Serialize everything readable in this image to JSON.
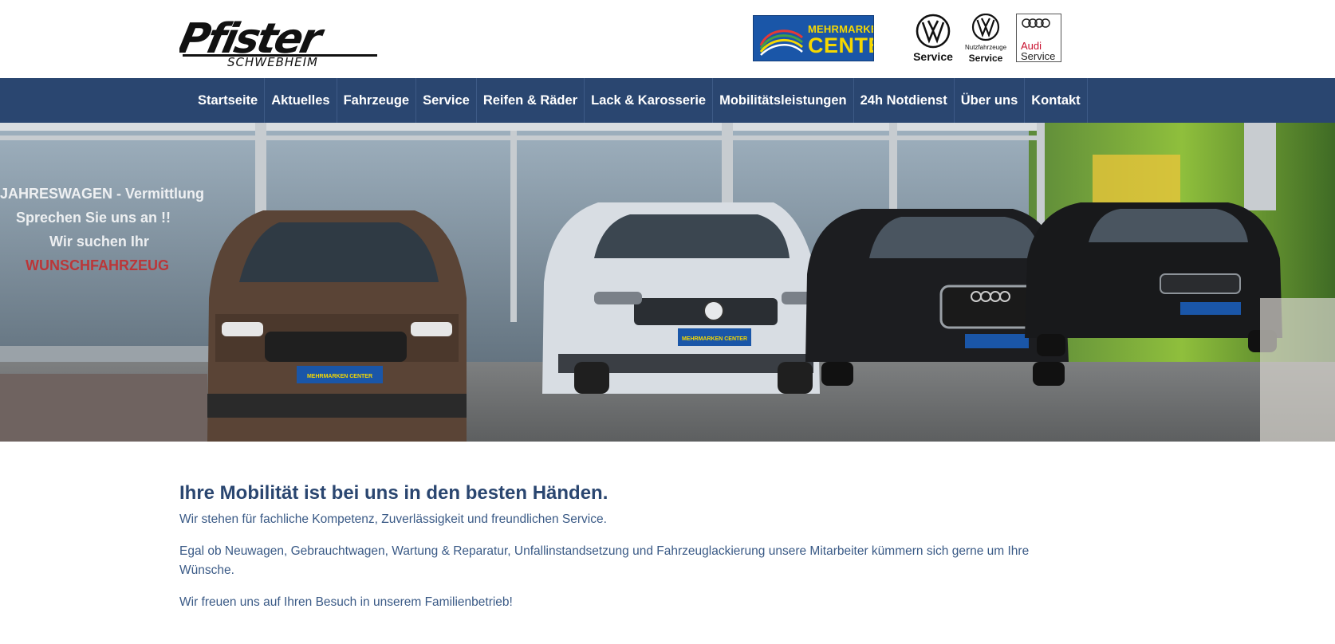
{
  "logo": {
    "name": "Pfister",
    "subtitle": "SCHWEBHEIM"
  },
  "brands": {
    "mehrmarken": {
      "top": "MEHRMARKEN",
      "bottom": "CENTER"
    },
    "vw": {
      "label": "Service"
    },
    "vw_nutzfahrzeuge": {
      "small": "Nutzfahrzeuge",
      "label": "Service"
    },
    "audi": {
      "line1": "Audi",
      "line2": "Service"
    }
  },
  "nav": {
    "items": [
      {
        "label": "Startseite"
      },
      {
        "label": "Aktuelles"
      },
      {
        "label": "Fahrzeuge"
      },
      {
        "label": "Service"
      },
      {
        "label": "Reifen & Räder"
      },
      {
        "label": "Lack & Karosserie"
      },
      {
        "label": "Mobilitätsleistungen"
      },
      {
        "label": "24h Notdienst"
      },
      {
        "label": "Über uns"
      },
      {
        "label": "Kontakt"
      }
    ]
  },
  "hero": {
    "window_text": [
      "JAHRESWAGEN - Vermittlung",
      "Sprechen Sie uns an !!",
      "Wir suchen Ihr",
      "WUNSCHFAHRZEUG"
    ],
    "plate_text": "MEHRMARKEN CENTER"
  },
  "content": {
    "heading": "Ihre Mobilität ist bei uns in den besten Händen.",
    "paragraph1": "Wir stehen für fachliche Kompetenz, Zuverlässigkeit und freundlichen Service.",
    "paragraph2": "Egal ob Neuwagen, Gebrauchtwagen, Wartung & Reparatur, Unfallinstandsetzung und Fahrzeuglackierung unsere Mitarbeiter kümmern sich gerne um Ihre Wünsche.",
    "paragraph3": "Wir freuen uns auf Ihren Besuch in unserem Familienbetrieb!"
  },
  "colors": {
    "nav_bg": "#2a4670",
    "heading": "#2a4670",
    "text": "#3a5a86",
    "brand_yellow": "#f6d800",
    "brand_blue": "#1a56a8"
  }
}
